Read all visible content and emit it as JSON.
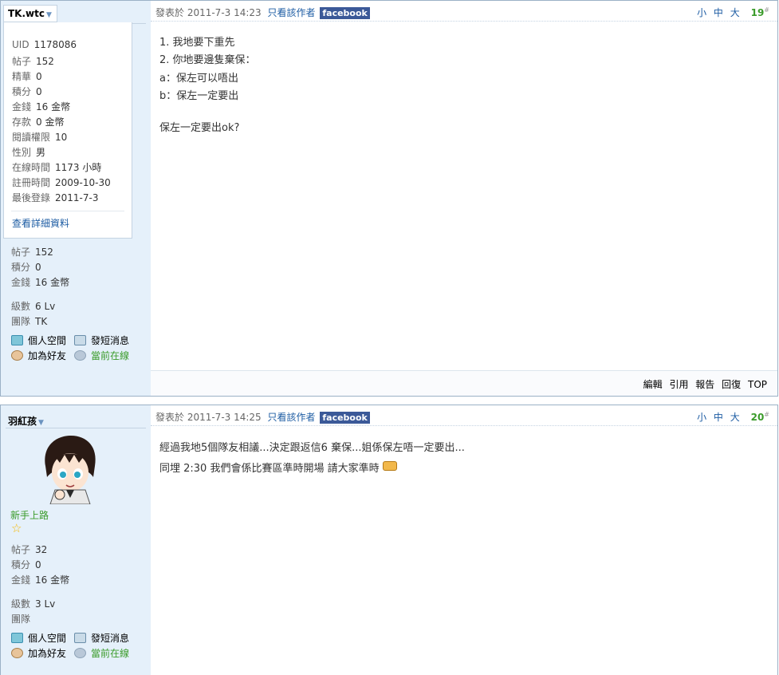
{
  "post1": {
    "username": "TK.wtc",
    "profile": [
      {
        "k": "UID",
        "v": "1178086"
      },
      {
        "k": "帖子",
        "v": "152"
      },
      {
        "k": "精華",
        "v": "0"
      },
      {
        "k": "積分",
        "v": "0"
      },
      {
        "k": "金錢",
        "v": "16 金幣"
      },
      {
        "k": "存款",
        "v": "0 金幣"
      },
      {
        "k": "閱讀權限",
        "v": "10"
      },
      {
        "k": "性別",
        "v": "男"
      },
      {
        "k": "在線時間",
        "v": "1173 小時"
      },
      {
        "k": "註冊時間",
        "v": "2009-10-30"
      },
      {
        "k": "最後登錄",
        "v": "2011-7-3"
      }
    ],
    "detail_link": "查看詳細資料",
    "stats": [
      {
        "k": "帖子",
        "v": "152"
      },
      {
        "k": "積分",
        "v": "0"
      },
      {
        "k": "金錢",
        "v": "16 金幣"
      }
    ],
    "level": {
      "k": "級數",
      "v": "6 Lv"
    },
    "team": {
      "k": "團隊",
      "v": "TK"
    },
    "actions": {
      "space": "個人空間",
      "message": "發短消息",
      "add_friend": "加為好友",
      "online": "當前在線"
    },
    "meta": {
      "posted": "發表於 2011-7-3 14:23",
      "author_only": "只看該作者",
      "facebook": "facebook"
    },
    "sizes": {
      "small": "小",
      "medium": "中",
      "large": "大"
    },
    "floor": "19",
    "content": [
      "1. 我地要下重先",
      "2. 你地要邊隻棄保：",
      "a：保左可以唔出",
      "b：保左一定要出",
      "保左一定要出ok?"
    ],
    "footer": {
      "edit": "編輯",
      "quote": "引用",
      "report": "報告",
      "reply": "回復",
      "top": "TOP"
    }
  },
  "post2": {
    "username": "羽紅孩",
    "rank": "新手上路",
    "stats": [
      {
        "k": "帖子",
        "v": "32"
      },
      {
        "k": "積分",
        "v": "0"
      },
      {
        "k": "金錢",
        "v": "16 金幣"
      }
    ],
    "level": {
      "k": "級數",
      "v": "3 Lv"
    },
    "team": {
      "k": "團隊",
      "v": ""
    },
    "actions": {
      "space": "個人空間",
      "message": "發短消息",
      "add_friend": "加為好友",
      "online": "當前在線"
    },
    "meta": {
      "posted": "發表於 2011-7-3 14:25",
      "author_only": "只看該作者",
      "facebook": "facebook"
    },
    "sizes": {
      "small": "小",
      "medium": "中",
      "large": "大"
    },
    "floor": "20",
    "content": [
      "經過我地5個隊友相議...決定跟返信6 棄保...姐係保左唔一定要出...",
      "同埋 2:30 我們會係比賽區準時開場 請大家準時"
    ]
  },
  "icons": {
    "home": "home-icon",
    "message": "message-icon",
    "friend": "add-friend-icon",
    "online": "online-icon",
    "star": "star-icon",
    "emoji": "handshake-emoji-icon"
  }
}
